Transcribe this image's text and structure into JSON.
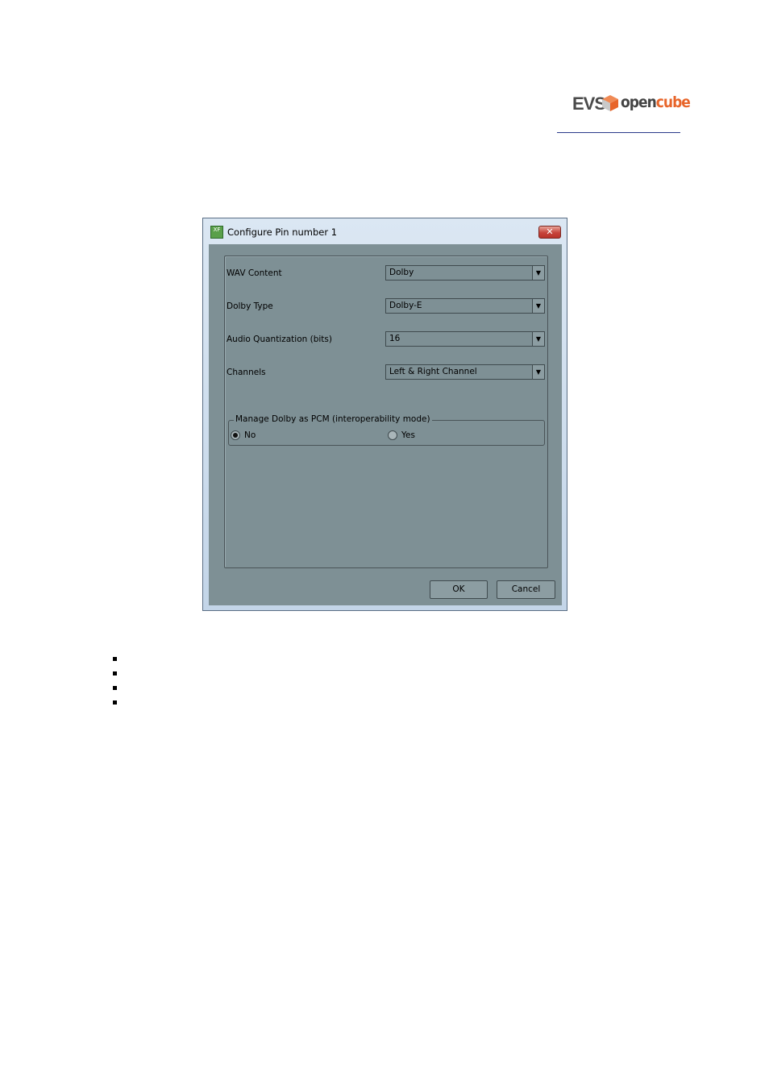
{
  "logo": {
    "evs": "EVS",
    "open": "open",
    "cube": "cube"
  },
  "window": {
    "title": "Configure Pin number 1",
    "icon_text": "XF",
    "close_glyph": "✕",
    "fields": [
      {
        "label": "WAV Content",
        "value": "Dolby"
      },
      {
        "label": "Dolby Type",
        "value": "Dolby-E"
      },
      {
        "label": "Audio Quantization (bits)",
        "value": "16"
      },
      {
        "label": "Channels",
        "value": "Left & Right Channel"
      }
    ],
    "group": {
      "title": "Manage Dolby as PCM (interoperability mode)",
      "options": [
        {
          "label": "No",
          "selected": true
        },
        {
          "label": "Yes",
          "selected": false
        }
      ]
    },
    "buttons": {
      "ok": "OK",
      "cancel": "Cancel"
    }
  },
  "icons": {
    "dropdown": "chevron-down-icon",
    "close": "close-icon",
    "app": "app-icon"
  },
  "colors": {
    "client_bg": "#7e9095",
    "logo_orange": "#e8652a",
    "rule_blue": "#2a3a8a"
  }
}
